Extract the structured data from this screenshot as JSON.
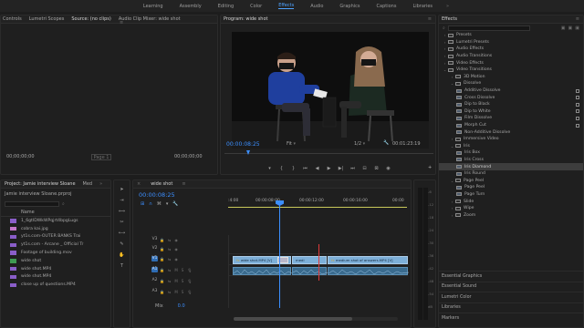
{
  "workspaces": [
    "Learning",
    "Assembly",
    "Editing",
    "Color",
    "Effects",
    "Audio",
    "Graphics",
    "Captions",
    "Libraries"
  ],
  "active_workspace": "Effects",
  "source_panel": {
    "tabs": [
      "Controls",
      "Lumetri Scopes",
      "Source: (no clips)",
      "Audio Clip Mixer: wide shot"
    ],
    "active_tab": "Source: (no clips)",
    "timecode_left": "00;00;00;00",
    "page": "Page 1",
    "timecode_right": "00;00;00;00"
  },
  "program_panel": {
    "title": "Program: wide shot",
    "timecode": "00:00:08:25",
    "fit": "Fit",
    "resolution": "1/2",
    "duration": "00:01:23:19"
  },
  "effects_panel": {
    "title": "Effects",
    "items": [
      {
        "label": "Presets",
        "level": 0,
        "type": "folder"
      },
      {
        "label": "Lumetri Presets",
        "level": 0,
        "type": "folder"
      },
      {
        "label": "Audio Effects",
        "level": 0,
        "type": "folder"
      },
      {
        "label": "Audio Transitions",
        "level": 0,
        "type": "folder"
      },
      {
        "label": "Video Effects",
        "level": 0,
        "type": "folder"
      },
      {
        "label": "Video Transitions",
        "level": 0,
        "type": "folder-open"
      },
      {
        "label": "3D Motion",
        "level": 1,
        "type": "folder"
      },
      {
        "label": "Dissolve",
        "level": 1,
        "type": "folder-open"
      },
      {
        "label": "Additive Dissolve",
        "level": 2,
        "type": "effect",
        "badge": true
      },
      {
        "label": "Cross Dissolve",
        "level": 2,
        "type": "effect",
        "badge": true
      },
      {
        "label": "Dip to Black",
        "level": 2,
        "type": "effect",
        "badge": true
      },
      {
        "label": "Dip to White",
        "level": 2,
        "type": "effect",
        "badge": true
      },
      {
        "label": "Film Dissolve",
        "level": 2,
        "type": "effect",
        "badge": true
      },
      {
        "label": "Morph Cut",
        "level": 2,
        "type": "effect",
        "badge": true
      },
      {
        "label": "Non-Additive Dissolve",
        "level": 2,
        "type": "effect"
      },
      {
        "label": "Immersive Video",
        "level": 1,
        "type": "folder"
      },
      {
        "label": "Iris",
        "level": 1,
        "type": "folder-open"
      },
      {
        "label": "Iris Box",
        "level": 2,
        "type": "effect"
      },
      {
        "label": "Iris Cross",
        "level": 2,
        "type": "effect"
      },
      {
        "label": "Iris Diamond",
        "level": 2,
        "type": "effect",
        "selected": true
      },
      {
        "label": "Iris Round",
        "level": 2,
        "type": "effect"
      },
      {
        "label": "Page Peel",
        "level": 1,
        "type": "folder-open"
      },
      {
        "label": "Page Peel",
        "level": 2,
        "type": "effect"
      },
      {
        "label": "Page Turn",
        "level": 2,
        "type": "effect"
      },
      {
        "label": "Slide",
        "level": 1,
        "type": "folder"
      },
      {
        "label": "Wipe",
        "level": 1,
        "type": "folder"
      },
      {
        "label": "Zoom",
        "level": 1,
        "type": "folder"
      }
    ],
    "bottom_panels": [
      "Essential Graphics",
      "Essential Sound",
      "Lumetri Color",
      "Libraries",
      "Markers"
    ]
  },
  "project_panel": {
    "tabs": [
      "Project: Jamie interview Sloane",
      "Med"
    ],
    "filename": "Jamie interview Sloane.prproj",
    "column_name": "Name",
    "items": [
      {
        "name": "1_6gtIDWkWPqjrt4bpgLugs",
        "color": "#8a5ec9"
      },
      {
        "name": "cobra kai.jpg",
        "color": "#c576c9"
      },
      {
        "name": "yt1s.com-OUTER BANKS Trai",
        "color": "#8a5ec9"
      },
      {
        "name": "yt1s.com - Arcane _ Official Tr",
        "color": "#8a5ec9"
      },
      {
        "name": "Footage of building.mov",
        "color": "#8a5ec9"
      },
      {
        "name": "wide shot",
        "color": "#3f9a53"
      },
      {
        "name": "wide shot.MP4",
        "color": "#8a5ec9"
      },
      {
        "name": "wide shot.MP4",
        "color": "#8a5ec9"
      },
      {
        "name": "close up of questions.MP4",
        "color": "#8a5ec9"
      }
    ]
  },
  "timeline": {
    "tab": "wide shot",
    "timecode": "00:00:08:25",
    "ruler_labels": [
      ":4:00",
      "00:00:08:00",
      "00:00:12:00",
      "00:00:16:00",
      "00:00"
    ],
    "tracks": [
      {
        "name": "V3",
        "kind": "video"
      },
      {
        "name": "V2",
        "kind": "video"
      },
      {
        "name": "V1",
        "kind": "video",
        "target": true
      },
      {
        "name": "A1",
        "kind": "audio",
        "target": true
      },
      {
        "name": "A2",
        "kind": "audio"
      },
      {
        "name": "A3",
        "kind": "audio"
      }
    ],
    "mix_label": "Mix",
    "mix_value": "0.0",
    "clips": {
      "c1": "wide shot.MP4 [V]",
      "c2": "medi",
      "c3": "medium shot of answers.MP4 [V]",
      "fx_badge": "fx"
    },
    "meter_labels": [
      "-6",
      "-12",
      "-18",
      "-24",
      "-30",
      "-36",
      "-42",
      "-48",
      "-54",
      "dB"
    ]
  }
}
